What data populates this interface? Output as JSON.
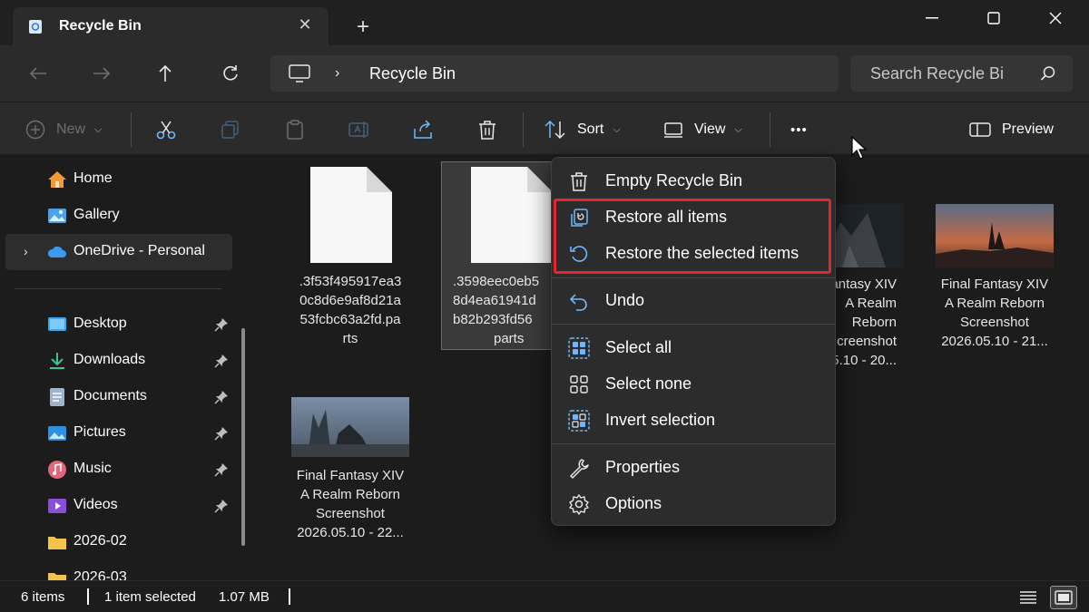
{
  "window": {
    "tab_title": "Recycle Bin",
    "tab_close": "✕",
    "new_tab": "+"
  },
  "address": {
    "crumb": "Recycle Bin",
    "separator": "›",
    "search_placeholder": "Search Recycle Bi"
  },
  "commands": {
    "new_label": "New",
    "sort_label": "Sort",
    "view_label": "View",
    "more_label": "•••",
    "preview_label": "Preview",
    "dropdown": "⌵"
  },
  "sidebar": {
    "items": [
      {
        "label": "Home",
        "icon": "home-icon"
      },
      {
        "label": "Gallery",
        "icon": "gallery-icon"
      },
      {
        "label": "OneDrive - Personal",
        "icon": "onedrive-icon"
      },
      {
        "label": "Desktop",
        "icon": "desktop-folder-icon"
      },
      {
        "label": "Downloads",
        "icon": "downloads-folder-icon"
      },
      {
        "label": "Documents",
        "icon": "documents-folder-icon"
      },
      {
        "label": "Pictures",
        "icon": "pictures-folder-icon"
      },
      {
        "label": "Music",
        "icon": "music-folder-icon"
      },
      {
        "label": "Videos",
        "icon": "videos-folder-icon"
      },
      {
        "label": "2026-02",
        "icon": "folder-icon"
      },
      {
        "label": "2026-03",
        "icon": "folder-icon"
      }
    ],
    "expand": "›"
  },
  "files": [
    {
      "name": ".3f53f495917ea30c8d6e9af8d21a53fcbc63a2fd.parts",
      "lines": [
        ".3f53f495917ea3",
        "0c8d6e9af8d21a",
        "53fcbc63a2fd.pa",
        "rts"
      ]
    },
    {
      "name": ".3598eec0eb5...parts",
      "lines": [
        ".3598eec0eb5",
        "8d4ea61941d",
        "b82b293fd56",
        "parts"
      ]
    },
    {
      "name": "Final Fantasy XIV A Realm Reborn Screenshot 2026.05.10 - 20...",
      "lines": [
        "antasy XIV",
        "A Realm Reborn",
        "creenshot",
        "5.10 - 20..."
      ]
    },
    {
      "name": "Final Fantasy XIV A Realm Reborn Screenshot 2026.05.10 - 21...",
      "lines": [
        "Final Fantasy XIV",
        "A Realm Reborn",
        "Screenshot",
        "2026.05.10 - 21..."
      ]
    },
    {
      "name": "Final Fantasy XIV A Realm Reborn Screenshot 2026.05.10 - 22...",
      "lines": [
        "Final Fantasy XIV",
        "A Realm Reborn",
        "Screenshot",
        "2026.05.10 - 22..."
      ]
    }
  ],
  "menu": {
    "items": [
      {
        "label": "Empty Recycle Bin",
        "icon": "trash-icon"
      },
      {
        "label": "Restore all items",
        "icon": "restore-all-icon"
      },
      {
        "label": "Restore the selected items",
        "icon": "restore-icon"
      },
      {
        "label": "Undo",
        "icon": "undo-icon"
      },
      {
        "label": "Select all",
        "icon": "select-all-icon"
      },
      {
        "label": "Select none",
        "icon": "select-none-icon"
      },
      {
        "label": "Invert selection",
        "icon": "invert-selection-icon"
      },
      {
        "label": "Properties",
        "icon": "wrench-icon"
      },
      {
        "label": "Options",
        "icon": "gear-icon"
      }
    ]
  },
  "status": {
    "item_count": "6 items",
    "selected": "1 item selected",
    "size": "1.07 MB"
  },
  "colors": {
    "accent": "#4cc2ff",
    "highlight_border": "#e5242b",
    "folder": "#f3c34a"
  }
}
